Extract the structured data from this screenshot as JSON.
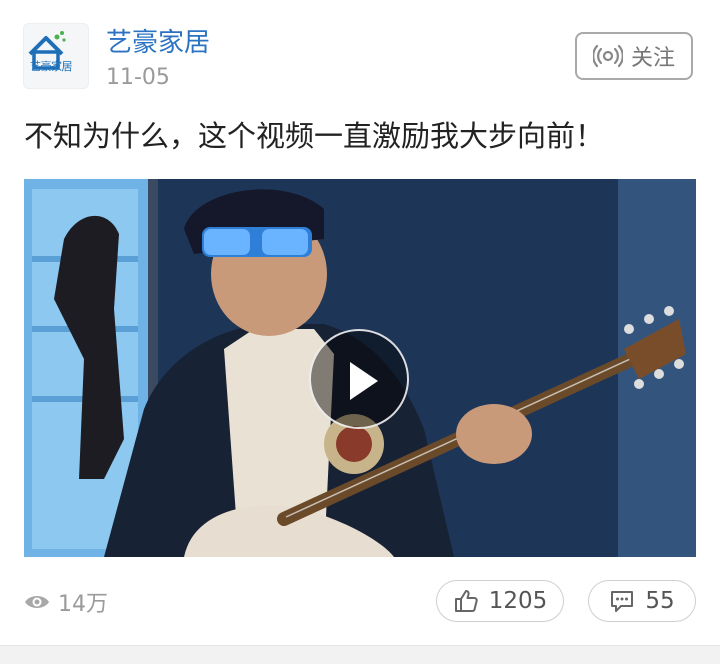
{
  "author": {
    "name": "艺豪家居",
    "date": "11-05",
    "logo_text": "艺豪家居"
  },
  "follow": {
    "label": "关注",
    "icon": "broadcast-icon"
  },
  "post": {
    "text": "不知为什么，这个视频一直激励我大步向前！"
  },
  "video": {
    "icon": "play-icon"
  },
  "stats": {
    "views": "14万",
    "likes": "1205",
    "comments": "55",
    "views_icon": "eye-icon",
    "likes_icon": "thumb-up-icon",
    "comments_icon": "comment-icon"
  },
  "colors": {
    "accent": "#2b73c2",
    "muted": "#9a9a9a",
    "text": "#222222"
  }
}
